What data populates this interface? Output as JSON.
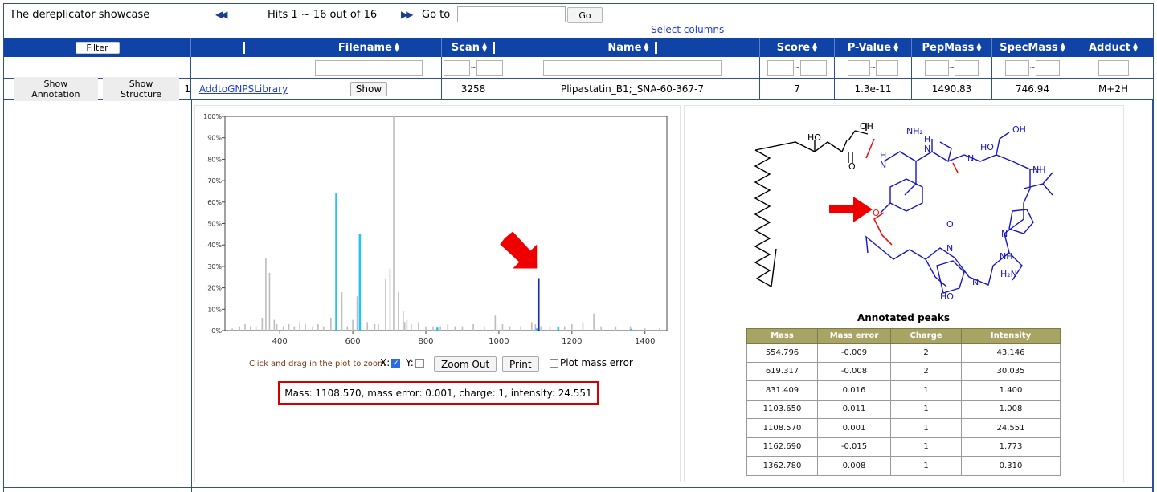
{
  "app": {
    "title": "The dereplicator showcase"
  },
  "pager": {
    "first_icon": "rewind-icon",
    "hits_text": "Hits 1 ~ 16 out of 16",
    "next_icon": "fast-forward-icon",
    "goto_label": "Go to",
    "goto_value": "",
    "goto_button": "Go"
  },
  "select_columns": "Select columns",
  "header": {
    "filter_button": "Filter",
    "columns": [
      "Filename",
      "Scan",
      "Name",
      "Score",
      "P-Value",
      "PepMass",
      "SpecMass",
      "Adduct"
    ]
  },
  "filter_row": {
    "range_sep": "~"
  },
  "row": {
    "show_annotation": "Show Annotation",
    "show_structure": "Show Structure",
    "index": "1",
    "library_link": "AddtoGNPSLibrary",
    "show_button": "Show",
    "scan": "3258",
    "name": "Plipastatin_B1;_SNA-60-367-7",
    "score": "7",
    "pvalue": "1.3e-11",
    "pepmass": "1490.83",
    "specmass": "746.94",
    "adduct": "M+2H"
  },
  "plot": {
    "zoom_hint": "Click and drag in the plot to zoom",
    "x_label": "X:",
    "x_checked": true,
    "y_label": "Y:",
    "y_checked": false,
    "zoom_out": "Zoom Out",
    "print": "Print",
    "mass_error_label": "Plot mass error",
    "mass_error_checked": false,
    "info": "Mass: 1108.570, mass error: 0.001, charge: 1, intensity: 24.551"
  },
  "chart_data": {
    "type": "bar",
    "xlim": [
      250,
      1460
    ],
    "ylim": [
      0,
      100
    ],
    "x_ticks": [
      "400",
      "600",
      "800",
      "1000",
      "1200",
      "1400"
    ],
    "y_ticks": [
      "0%",
      "10%",
      "20%",
      "30%",
      "40%",
      "50%",
      "60%",
      "70%",
      "80%",
      "90%",
      "100%"
    ],
    "grid": false,
    "series": [
      {
        "role": "unannotated",
        "color": "#bdbdbd",
        "x": [
          270,
          290,
          305,
          320,
          335,
          352,
          362,
          372,
          385,
          392,
          410,
          425,
          440,
          455,
          470,
          490,
          505,
          520,
          540,
          555,
          570,
          585,
          600,
          612,
          640,
          660,
          670,
          690,
          702,
          712,
          725,
          738,
          742,
          748,
          760,
          780,
          800,
          820,
          840,
          860,
          880,
          900,
          930,
          960,
          990,
          1010,
          1030,
          1060,
          1090,
          1100,
          1115,
          1140,
          1180,
          1200,
          1230,
          1260,
          1280,
          1320,
          1360,
          1400,
          1440
        ],
        "values": [
          1,
          2,
          3,
          2,
          2,
          6,
          34,
          27,
          5,
          3,
          2,
          3,
          2,
          4,
          3,
          2,
          3,
          2,
          6,
          4,
          18,
          2,
          5,
          16,
          4,
          3,
          3,
          24,
          29,
          100,
          18,
          9,
          4,
          5,
          3,
          4,
          2,
          2,
          2,
          3,
          2,
          2,
          3,
          2,
          7,
          3,
          2,
          2,
          4,
          3,
          2,
          2,
          2,
          3,
          4,
          8,
          2,
          2,
          2,
          1,
          1
        ]
      },
      {
        "role": "annotated",
        "color": "#28c2ee",
        "x": [
          554.796,
          619.317,
          831.409,
          1103.65,
          1162.69,
          1362.78
        ],
        "values": [
          64,
          45,
          1.4,
          1.0,
          1.8,
          0.31
        ]
      },
      {
        "role": "selected",
        "color": "#1a2ea8",
        "x": [
          1108.57
        ],
        "values": [
          24.551
        ]
      }
    ]
  },
  "structure": {
    "image_name": "plipastatin-structure",
    "labels": [
      "HO",
      "OH",
      "O",
      "NH2",
      "N",
      "H",
      "HO",
      "OH",
      "O",
      "NH",
      "H2N",
      "OH"
    ]
  },
  "annotated_peaks": {
    "title": "Annotated peaks",
    "headers": [
      "Mass",
      "Mass error",
      "Charge",
      "Intensity"
    ],
    "rows": [
      [
        "554.796",
        "-0.009",
        "2",
        "43.146"
      ],
      [
        "619.317",
        "-0.008",
        "2",
        "30.035"
      ],
      [
        "831.409",
        "0.016",
        "1",
        "1.400"
      ],
      [
        "1103.650",
        "0.011",
        "1",
        "1.008"
      ],
      [
        "1108.570",
        "0.001",
        "1",
        "24.551"
      ],
      [
        "1162.690",
        "-0.015",
        "1",
        "1.773"
      ],
      [
        "1362.780",
        "0.008",
        "1",
        "0.310"
      ]
    ]
  }
}
